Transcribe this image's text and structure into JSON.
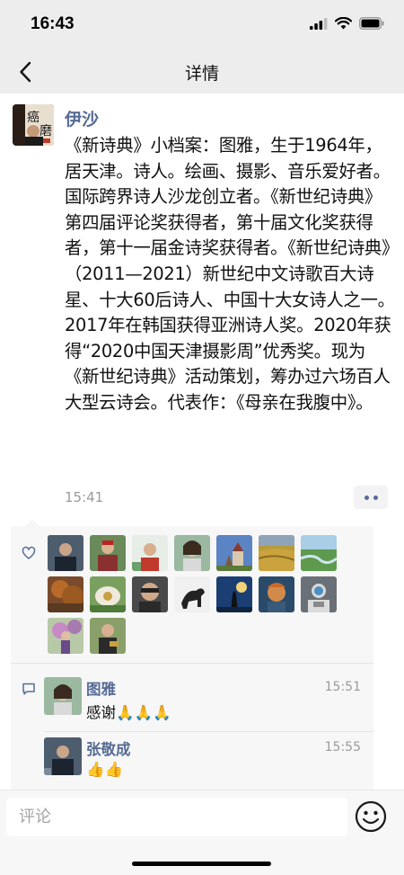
{
  "status_bar": {
    "time": "16:43"
  },
  "nav": {
    "title": "详情"
  },
  "post": {
    "author": "伊沙",
    "text": "《新诗典》小档案：图雅，生于1964年，居天津。诗人。绘画、摄影、音乐爱好者。国际跨界诗人沙龙创立者。《新世纪诗典》第四届评论奖获得者，第十届文化奖获得者，第十一届金诗奖获得者。《新世纪诗典》（2011—2021）新世纪中文诗歌百大诗星、十大60后诗人、中国十大女诗人之一。2017年在韩国获得亚洲诗人奖。2020年获得“2020中国天津摄影周”优秀奖。现为《新世纪诗典》活动策划，筹办过六场百人大型云诗会。代表作：《母亲在我腹中》。",
    "time": "15:41"
  },
  "likes": {
    "icon": "heart-icon",
    "count_visible": 16
  },
  "comments": [
    {
      "author": "图雅",
      "time": "15:51",
      "text": "感谢🙏🙏🙏"
    },
    {
      "author": "张敬成",
      "time": "15:55",
      "text": "👍👍"
    }
  ],
  "input": {
    "placeholder": "评论"
  },
  "colors": {
    "link": "#576b95",
    "bar_bg": "#ededed",
    "panel_bg": "#f7f7f7"
  }
}
